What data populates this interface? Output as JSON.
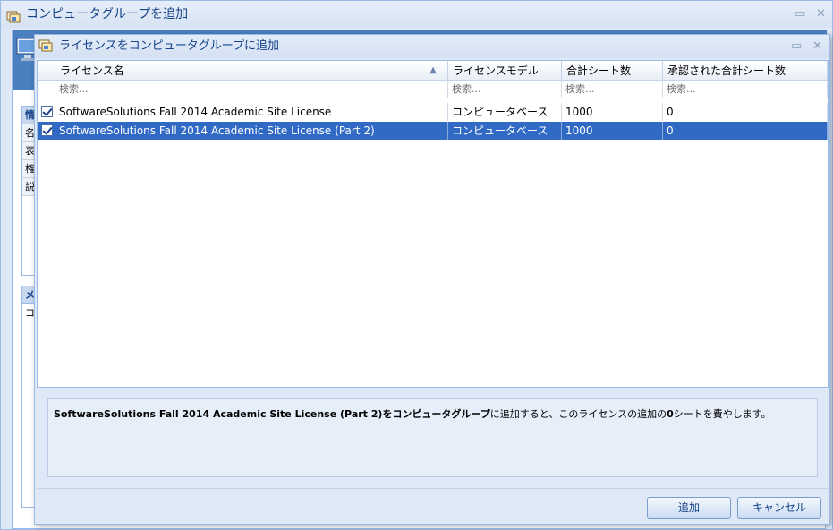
{
  "outer_window": {
    "title": "コンピュータグループを追加",
    "left_panel": {
      "section1_header": "情",
      "section1_rows": [
        "名",
        "表",
        "権",
        "説"
      ],
      "section2_header": "メ",
      "section2_rows": [
        "コ"
      ]
    }
  },
  "dialog": {
    "title": "ライセンスをコンピュータグループに追加",
    "grid": {
      "columns": [
        "ライセンス名",
        "ライセンスモデル",
        "合計シート数",
        "承認された合計シート数"
      ],
      "filter_placeholder": "検索...",
      "rows": [
        {
          "checked": true,
          "selected": false,
          "name": "SoftwareSolutions Fall 2014 Academic Site License",
          "model": "コンピュータベース",
          "total_seats": "1000",
          "approved_seats": "0"
        },
        {
          "checked": true,
          "selected": true,
          "name": "SoftwareSolutions Fall 2014 Academic Site License (Part 2)",
          "model": "コンピュータベース",
          "total_seats": "1000",
          "approved_seats": "0"
        }
      ]
    },
    "info": {
      "license_name": "SoftwareSolutions Fall 2014 Academic Site License (Part 2)",
      "part1": "を",
      "group": "コンピュータグループ",
      "part2": "に追加すると、このライセンスの追加の",
      "seat_count": "0",
      "part3": "シートを費やします。"
    },
    "buttons": {
      "add": "追加",
      "cancel": "キャンセル"
    }
  },
  "window_controls": {
    "minimize": "▭",
    "close": "✕"
  },
  "colors": {
    "selection": "#316ac5",
    "title_text": "#15428b",
    "panel_bg": "#dfe8f6",
    "border": "#99bbe8"
  },
  "icons": [
    "app-window-icon",
    "computer-icon",
    "checkbox-checked-icon",
    "sort-ascending-icon"
  ]
}
